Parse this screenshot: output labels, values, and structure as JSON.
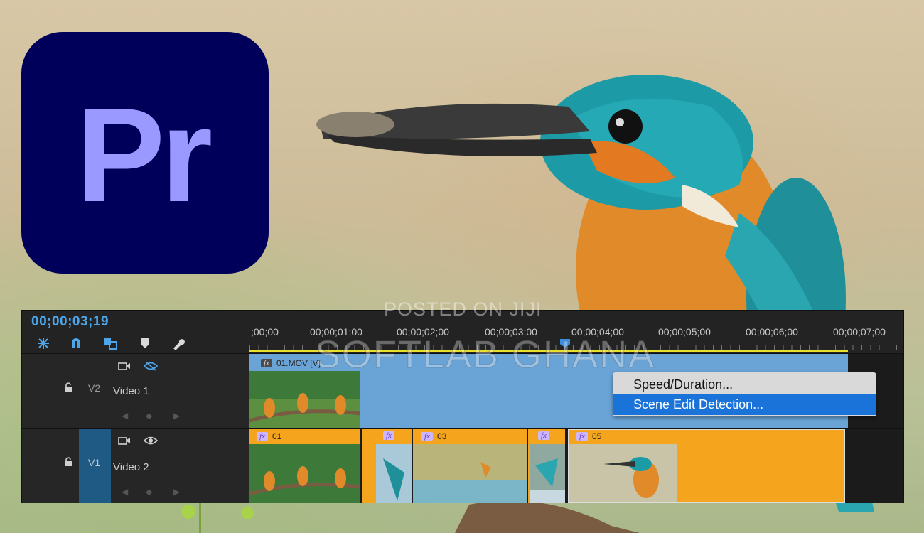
{
  "logo": {
    "text": "Pr",
    "background": "#00005b",
    "color": "#9999ff"
  },
  "watermark": {
    "line1": "POSTED ON JIJI",
    "line2": "SOFTLAB GHANA"
  },
  "timeline": {
    "timecode": "00;00;03;19",
    "tools": [
      "ripple-edit-icon",
      "snap-magnet-icon",
      "linked-selection-icon",
      "marker-icon",
      "wrench-icon"
    ],
    "ruler_labels": [
      ";00;00",
      "00;00;01;00",
      "00;00;02;00",
      "00;00;03;00",
      "00;00;04;00",
      "00;00;05;00",
      "00;00;06;00",
      "00;00;07;00"
    ],
    "accent_color": "#4ea6ea",
    "tracks": [
      {
        "id": "V2",
        "name": "Video 1",
        "visibility": "hidden"
      },
      {
        "id": "V1",
        "name": "Video 2",
        "visibility": "visible"
      }
    ],
    "clips_top": [
      {
        "label": "01.MOV [V]",
        "fx": "fx"
      }
    ],
    "clips_bottom": [
      {
        "label": "01",
        "fx": "fx"
      },
      {
        "label": "",
        "fx": "fx"
      },
      {
        "label": "03",
        "fx": "fx"
      },
      {
        "label": "",
        "fx": "fx"
      },
      {
        "label": "05",
        "fx": "fx"
      }
    ]
  },
  "context_menu": {
    "items": [
      {
        "label": "Speed/Duration..."
      },
      {
        "label": "Scene Edit Detection...",
        "selected": true
      }
    ]
  }
}
